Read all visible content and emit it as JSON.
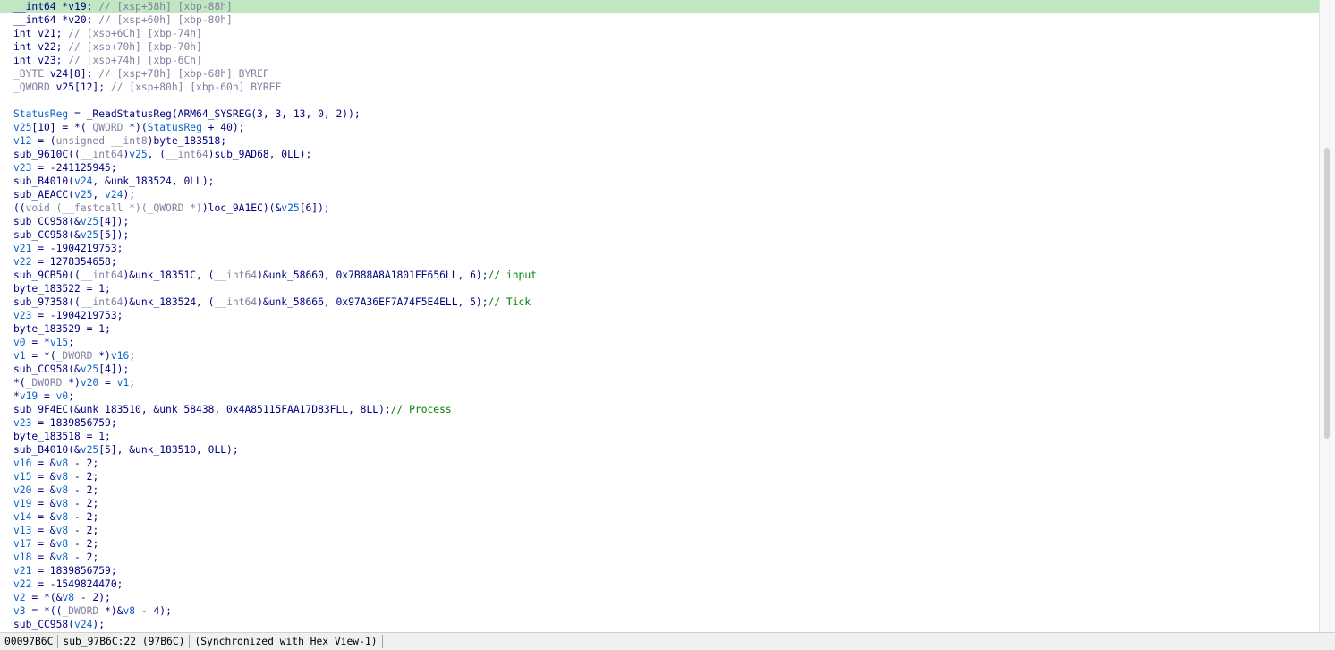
{
  "lines": [
    [
      [
        "kw",
        "__int64 *"
      ],
      [
        "kw",
        "v19"
      ],
      [
        "plain",
        "; "
      ],
      [
        "cmt",
        "// [xsp+58h] [xbp-88h]"
      ]
    ],
    [
      [
        "kw",
        "__int64 *"
      ],
      [
        "kw",
        "v20"
      ],
      [
        "plain",
        "; "
      ],
      [
        "cmt",
        "// [xsp+60h] [xbp-80h]"
      ]
    ],
    [
      [
        "kw",
        "int "
      ],
      [
        "kw",
        "v21"
      ],
      [
        "plain",
        "; "
      ],
      [
        "cmt",
        "// [xsp+6Ch] [xbp-74h]"
      ]
    ],
    [
      [
        "kw",
        "int "
      ],
      [
        "kw",
        "v22"
      ],
      [
        "plain",
        "; "
      ],
      [
        "cmt",
        "// [xsp+70h] [xbp-70h]"
      ]
    ],
    [
      [
        "kw",
        "int "
      ],
      [
        "kw",
        "v23"
      ],
      [
        "plain",
        "; "
      ],
      [
        "cmt",
        "// [xsp+74h] [xbp-6Ch]"
      ]
    ],
    [
      [
        "cmt",
        "_BYTE "
      ],
      [
        "kw",
        "v24[8]"
      ],
      [
        "plain",
        "; "
      ],
      [
        "cmt",
        "// [xsp+78h] [xbp-68h] BYREF"
      ]
    ],
    [
      [
        "cmt",
        "_QWORD "
      ],
      [
        "kw",
        "v25[12]"
      ],
      [
        "plain",
        "; "
      ],
      [
        "cmt",
        "// [xsp+80h] [xbp-60h] BYREF"
      ]
    ],
    [],
    [
      [
        "var",
        "StatusReg"
      ],
      [
        "plain",
        " = _ReadStatusReg(ARM64_SYSREG(3, 3, 13, 0, 2));"
      ]
    ],
    [
      [
        "var",
        "v25"
      ],
      [
        "plain",
        "[10] = *("
      ],
      [
        "cmt",
        "_QWORD"
      ],
      [
        "plain",
        " *)("
      ],
      [
        "var",
        "StatusReg"
      ],
      [
        "plain",
        " + 40);"
      ]
    ],
    [
      [
        "var",
        "v12"
      ],
      [
        "plain",
        " = ("
      ],
      [
        "cmt",
        "unsigned __int8"
      ],
      [
        "plain",
        ")byte_183518;"
      ]
    ],
    [
      [
        "plain",
        "sub_9610C(("
      ],
      [
        "cmt",
        "__int64"
      ],
      [
        "plain",
        ")"
      ],
      [
        "var",
        "v25"
      ],
      [
        "plain",
        ", ("
      ],
      [
        "cmt",
        "__int64"
      ],
      [
        "plain",
        ")sub_9AD68, 0LL);"
      ]
    ],
    [
      [
        "var",
        "v23"
      ],
      [
        "plain",
        " = -241125945;"
      ]
    ],
    [
      [
        "plain",
        "sub_B4010("
      ],
      [
        "var",
        "v24"
      ],
      [
        "plain",
        ", &unk_183524, 0LL);"
      ]
    ],
    [
      [
        "plain",
        "sub_AEACC("
      ],
      [
        "var",
        "v25"
      ],
      [
        "plain",
        ", "
      ],
      [
        "var",
        "v24"
      ],
      [
        "plain",
        ");"
      ]
    ],
    [
      [
        "plain",
        "(("
      ],
      [
        "cmt",
        "void (__fastcall *)(_QWORD *)"
      ],
      [
        "plain",
        ")loc_9A1EC)(&"
      ],
      [
        "var",
        "v25"
      ],
      [
        "plain",
        "[6]);"
      ]
    ],
    [
      [
        "plain",
        "sub_CC958(&"
      ],
      [
        "var",
        "v25"
      ],
      [
        "plain",
        "[4]);"
      ]
    ],
    [
      [
        "plain",
        "sub_CC958(&"
      ],
      [
        "var",
        "v25"
      ],
      [
        "plain",
        "[5]);"
      ]
    ],
    [
      [
        "var",
        "v21"
      ],
      [
        "plain",
        " = -1904219753;"
      ]
    ],
    [
      [
        "var",
        "v22"
      ],
      [
        "plain",
        " = 1278354658;"
      ]
    ],
    [
      [
        "plain",
        "sub_9CB50(("
      ],
      [
        "cmt",
        "__int64"
      ],
      [
        "plain",
        ")&unk_18351C, ("
      ],
      [
        "cmt",
        "__int64"
      ],
      [
        "plain",
        ")&unk_58660, 0x7B88A8A1801FE656LL, 6);"
      ],
      [
        "ucmt",
        "// input"
      ]
    ],
    [
      [
        "plain",
        "byte_183522 = 1;"
      ]
    ],
    [
      [
        "plain",
        "sub_97358(("
      ],
      [
        "cmt",
        "__int64"
      ],
      [
        "plain",
        ")&unk_183524, ("
      ],
      [
        "cmt",
        "__int64"
      ],
      [
        "plain",
        ")&unk_58666, 0x97A36EF7A74F5E4ELL, 5);"
      ],
      [
        "ucmt",
        "// Tick"
      ]
    ],
    [
      [
        "var",
        "v23"
      ],
      [
        "plain",
        " = -1904219753;"
      ]
    ],
    [
      [
        "plain",
        "byte_183529 = 1;"
      ]
    ],
    [
      [
        "var",
        "v0"
      ],
      [
        "plain",
        " = *"
      ],
      [
        "var",
        "v15"
      ],
      [
        "plain",
        ";"
      ]
    ],
    [
      [
        "var",
        "v1"
      ],
      [
        "plain",
        " = *("
      ],
      [
        "cmt",
        "_DWORD"
      ],
      [
        "plain",
        " *)"
      ],
      [
        "var",
        "v16"
      ],
      [
        "plain",
        ";"
      ]
    ],
    [
      [
        "plain",
        "sub_CC958(&"
      ],
      [
        "var",
        "v25"
      ],
      [
        "plain",
        "[4]);"
      ]
    ],
    [
      [
        "plain",
        "*("
      ],
      [
        "cmt",
        "_DWORD"
      ],
      [
        "plain",
        " *)"
      ],
      [
        "var",
        "v20"
      ],
      [
        "plain",
        " = "
      ],
      [
        "var",
        "v1"
      ],
      [
        "plain",
        ";"
      ]
    ],
    [
      [
        "plain",
        "*"
      ],
      [
        "var",
        "v19"
      ],
      [
        "plain",
        " = "
      ],
      [
        "var",
        "v0"
      ],
      [
        "plain",
        ";"
      ]
    ],
    [
      [
        "plain",
        "sub_9F4EC(&unk_183510, &unk_58438, 0x4A85115FAA17D83FLL, 8LL);"
      ],
      [
        "ucmt",
        "// Process"
      ]
    ],
    [
      [
        "var",
        "v23"
      ],
      [
        "plain",
        " = 1839856759;"
      ]
    ],
    [
      [
        "plain",
        "byte_183518 = 1;"
      ]
    ],
    [
      [
        "plain",
        "sub_B4010(&"
      ],
      [
        "var",
        "v25"
      ],
      [
        "plain",
        "[5], &unk_183510, 0LL);"
      ]
    ],
    [
      [
        "var",
        "v16"
      ],
      [
        "plain",
        " = &"
      ],
      [
        "var",
        "v8"
      ],
      [
        "plain",
        " - 2;"
      ]
    ],
    [
      [
        "var",
        "v15"
      ],
      [
        "plain",
        " = &"
      ],
      [
        "var",
        "v8"
      ],
      [
        "plain",
        " - 2;"
      ]
    ],
    [
      [
        "var",
        "v20"
      ],
      [
        "plain",
        " = &"
      ],
      [
        "var",
        "v8"
      ],
      [
        "plain",
        " - 2;"
      ]
    ],
    [
      [
        "var",
        "v19"
      ],
      [
        "plain",
        " = &"
      ],
      [
        "var",
        "v8"
      ],
      [
        "plain",
        " - 2;"
      ]
    ],
    [
      [
        "var",
        "v14"
      ],
      [
        "plain",
        " = &"
      ],
      [
        "var",
        "v8"
      ],
      [
        "plain",
        " - 2;"
      ]
    ],
    [
      [
        "var",
        "v13"
      ],
      [
        "plain",
        " = &"
      ],
      [
        "var",
        "v8"
      ],
      [
        "plain",
        " - 2;"
      ]
    ],
    [
      [
        "var",
        "v17"
      ],
      [
        "plain",
        " = &"
      ],
      [
        "var",
        "v8"
      ],
      [
        "plain",
        " - 2;"
      ]
    ],
    [
      [
        "var",
        "v18"
      ],
      [
        "plain",
        " = &"
      ],
      [
        "var",
        "v8"
      ],
      [
        "plain",
        " - 2;"
      ]
    ],
    [
      [
        "var",
        "v21"
      ],
      [
        "plain",
        " = 1839856759;"
      ]
    ],
    [
      [
        "var",
        "v22"
      ],
      [
        "plain",
        " = -1549824470;"
      ]
    ],
    [
      [
        "var",
        "v2"
      ],
      [
        "plain",
        " = *(&"
      ],
      [
        "var",
        "v8"
      ],
      [
        "plain",
        " - 2);"
      ]
    ],
    [
      [
        "var",
        "v3"
      ],
      [
        "plain",
        " = *(("
      ],
      [
        "cmt",
        "_DWORD"
      ],
      [
        "plain",
        " *)&"
      ],
      [
        "var",
        "v8"
      ],
      [
        "plain",
        " - 4);"
      ]
    ],
    [
      [
        "plain",
        "sub_CC958("
      ],
      [
        "var",
        "v24"
      ],
      [
        "plain",
        ");"
      ]
    ]
  ],
  "status": {
    "address": "00097B6C",
    "location": "sub_97B6C:22 (97B6C)",
    "sync": "(Synchronized with Hex View-1)"
  }
}
